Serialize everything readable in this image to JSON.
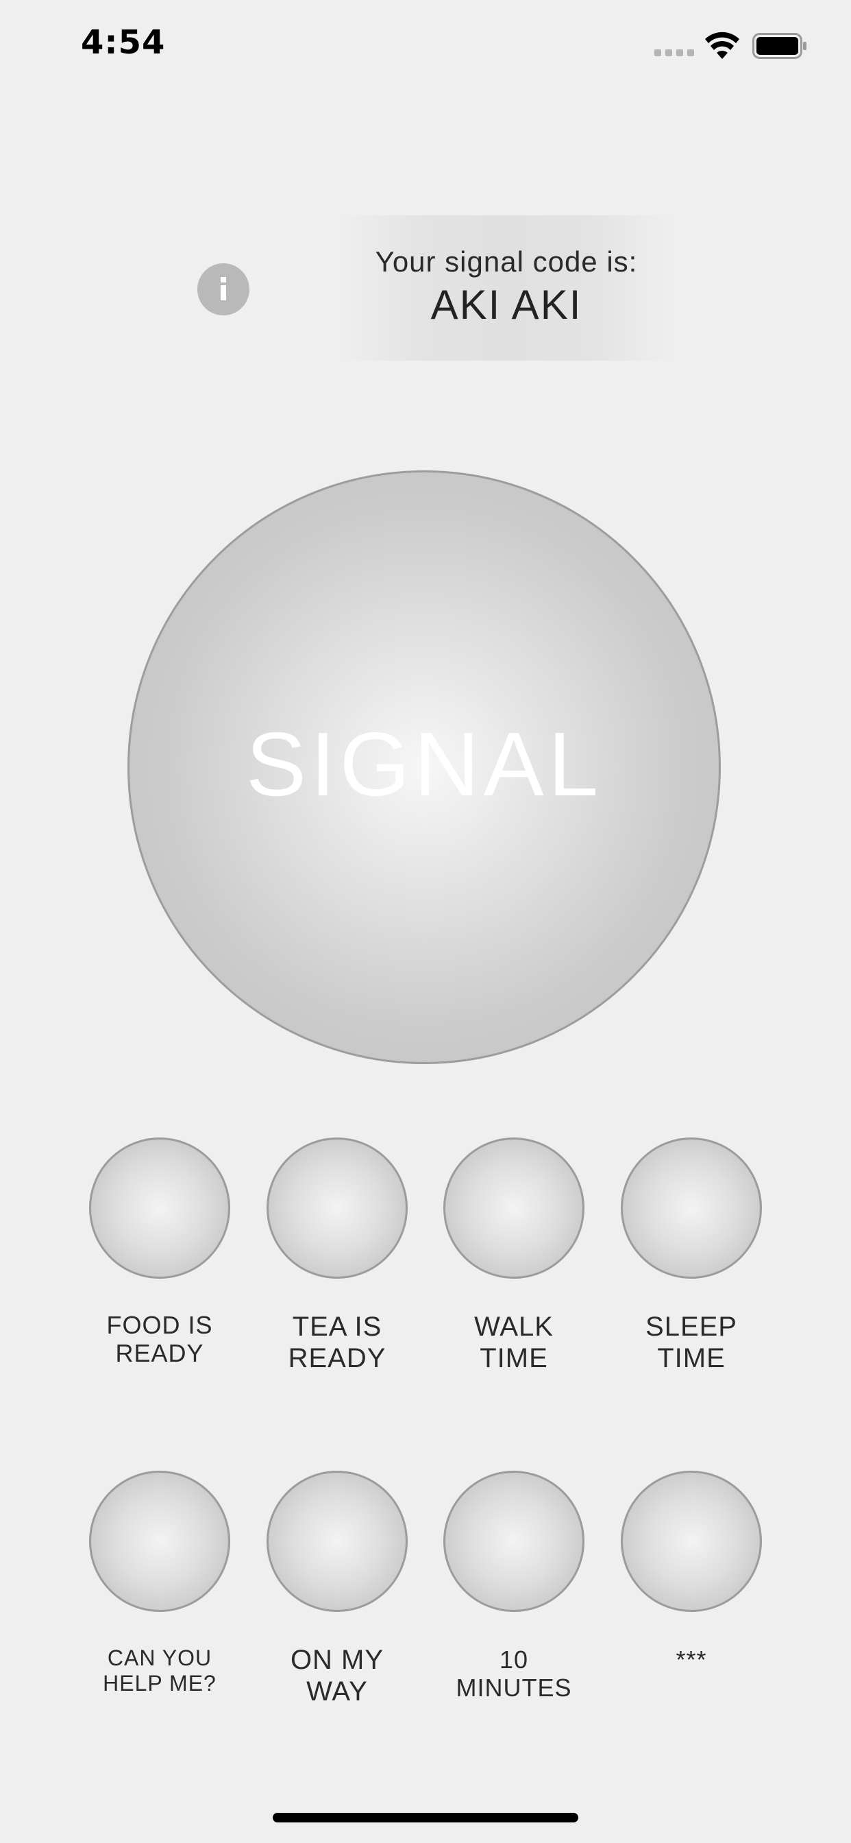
{
  "status_bar": {
    "time": "4:54",
    "cellular_icon": "cellular-signal-icon",
    "wifi_icon": "wifi-icon",
    "battery_icon": "battery-icon"
  },
  "header": {
    "info_icon": "info-icon",
    "code_label": "Your signal code is:",
    "code_value": "AKI AKI"
  },
  "main_button": {
    "label": "SIGNAL"
  },
  "quick_signals": [
    {
      "line1": "FOOD IS",
      "line2": "READY"
    },
    {
      "line1": "TEA IS",
      "line2": "READY"
    },
    {
      "line1": "WALK",
      "line2": "TIME"
    },
    {
      "line1": "SLEEP",
      "line2": "TIME"
    },
    {
      "line1": "CAN YOU",
      "line2": "HELP ME?"
    },
    {
      "line1": "ON MY",
      "line2": "WAY"
    },
    {
      "line1": "10",
      "line2": "MINUTES"
    },
    {
      "line1": "***",
      "line2": ""
    }
  ],
  "colors": {
    "background": "#efefef",
    "button_border": "#9c9c9c",
    "text": "#2a2a2a",
    "signal_text": "#ffffff"
  }
}
